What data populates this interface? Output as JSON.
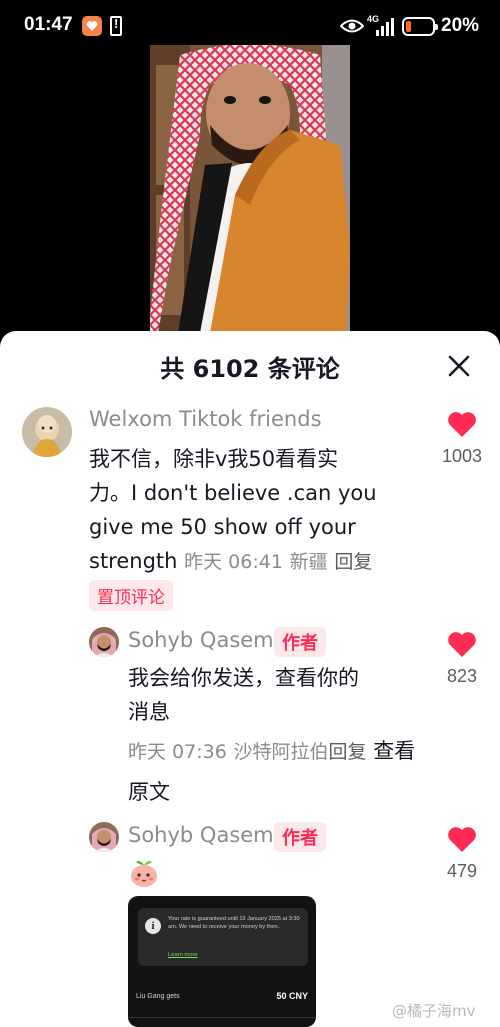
{
  "status_bar": {
    "time": "01:47",
    "network": "4G",
    "battery_percent_label": "20%",
    "battery_level": 0.2
  },
  "comments_panel": {
    "title": "共 6102 条评论",
    "close_icon": "close-icon"
  },
  "comments": [
    {
      "username": "Welxom Tiktok friends",
      "text_lines": [
        "我不信，除非v我50看看实",
        "力。I don't believe  .can you",
        "give me 50  show off your",
        "strength"
      ],
      "time": "昨天 06:41",
      "location": "新疆",
      "reply_label": "回复",
      "pinned_label": "置顶评论",
      "likes": "1003"
    },
    {
      "username": "Sohyb Qasem",
      "author_label": "作者",
      "text_lines": [
        "我会给你发送，查看你的",
        "消息"
      ],
      "time": "昨天 07:36",
      "location": "沙特阿拉伯",
      "reply_label": "回复",
      "view_original_label": "查看原文",
      "likes": "823"
    },
    {
      "username": "Sohyb Qasem",
      "author_label": "作者",
      "emoji": "peach-sticker",
      "likes": "479",
      "attachment": {
        "notice": "Your rate is guaranteed until 19 January 2025 at 3:30 am. We need to receive your money by then.",
        "link": "Learn more",
        "recipient_label": "Liu Gang gets",
        "amount": "50 CNY"
      }
    }
  ],
  "watermark": "@橘子海mv",
  "colors": {
    "accent": "#fe2c55",
    "secondary_text": "#8a8b91",
    "sheet_bg": "#ffffff"
  }
}
